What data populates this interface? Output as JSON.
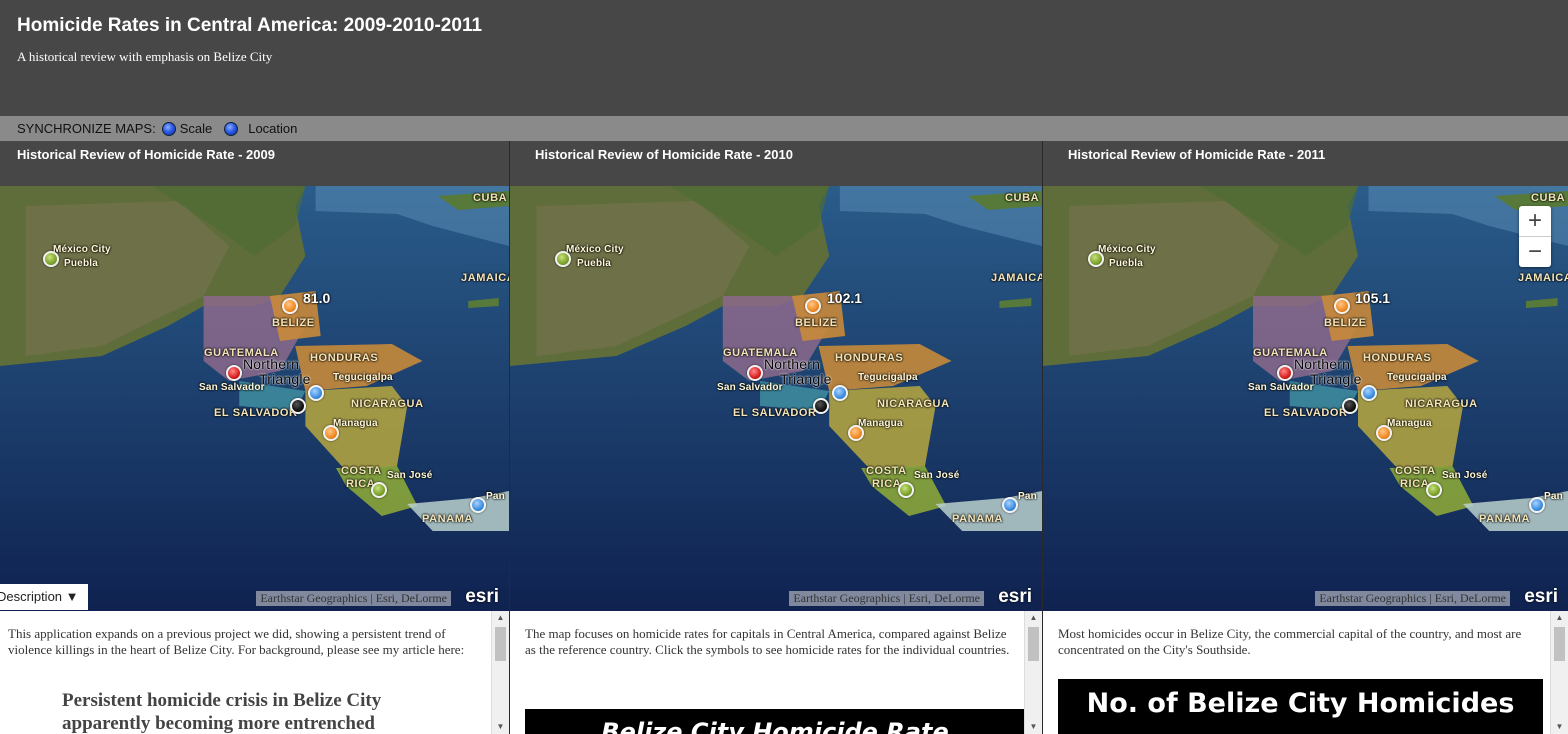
{
  "header": {
    "title": "Homicide Rates in Central America: 2009-2010-2011",
    "subtitle": "A historical review with emphasis on Belize City"
  },
  "sync": {
    "label": "SYNCHRONIZE MAPS:",
    "scale": "Scale",
    "location": "Location"
  },
  "colors": {
    "header_bg": "#474747",
    "syncbar_bg": "#8a8a8a",
    "marker_green": "#7aa22a",
    "marker_orange": "#f08a22",
    "marker_red": "#d81e1e",
    "marker_blue": "#3b8ee0",
    "marker_black": "#111111"
  },
  "map_labels": {
    "cuba": "CUBA",
    "jamaica": "JAMAICA",
    "belize": "BELIZE",
    "guatemala": "GUATEMALA",
    "honduras": "HONDURAS",
    "el_salvador": "EL SALVADOR",
    "nicaragua": "NICARAGUA",
    "costa_rica_1": "COSTA",
    "costa_rica_2": "RICA",
    "panama": "PANAMA",
    "mexico_city": "México City",
    "puebla": "Puebla",
    "san_salvador": "San Salvador",
    "tegucigalpa": "Tegucigalpa",
    "managua": "Managua",
    "san_jose": "San José",
    "panama_city": "Pan",
    "northern_triangle_1": "Northern",
    "northern_triangle_2": "Triangle",
    "attribution": "Earthstar Geographics | Esri, DeLorme",
    "esri": "esri"
  },
  "panels": [
    {
      "title": "Historical Review of Homicide Rate - 2009",
      "belize_rate": "81.0",
      "description": "This application expands on a previous project we did, showing a persistent trend of violence killings in the heart of Belize City. For background, please see my article here:",
      "quote": "Persistent homicide crisis in Belize City apparently becoming more entrenched",
      "toggle_label": "Description ▼"
    },
    {
      "title": "Historical Review of Homicide Rate - 2010",
      "belize_rate": "102.1",
      "description": "The map focuses on homicide rates for capitals in Central America, compared against Belize as the reference country. Click the symbols to see homicide rates for the individual countries.",
      "image_caption": "Belize City Homicide Rate"
    },
    {
      "title": "Historical Review of Homicide Rate - 2011",
      "belize_rate": "105.1",
      "description": "Most homicides occur in Belize City, the commercial capital of the country, and most are concentrated on the City's Southside.",
      "image_caption": "No. of Belize City Homicides",
      "zoom_in": "+",
      "zoom_out": "−"
    }
  ],
  "scroll": {
    "up": "▲",
    "down": "▼"
  }
}
